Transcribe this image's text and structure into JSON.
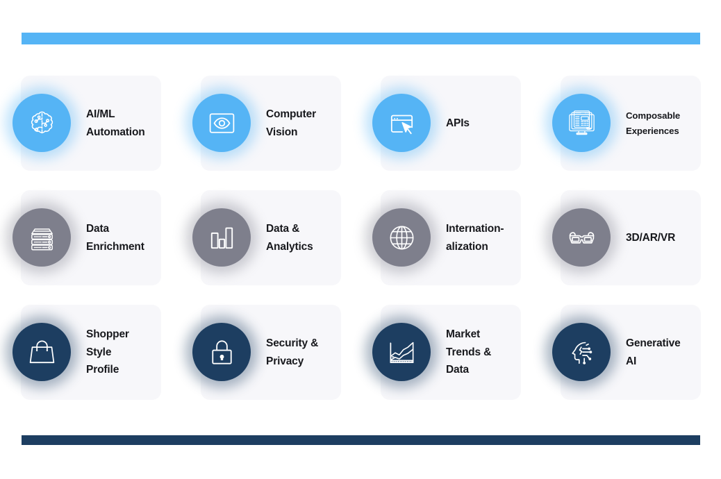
{
  "colors": {
    "accent_blue": "#55b4f5",
    "accent_navy": "#1d3e61",
    "icon_gray": "#7e7f8c",
    "card_bg": "#f7f7fa",
    "label_text": "#17181c",
    "page_bg": "#ffffff"
  },
  "bars": {
    "top": {
      "name": "top-accent-bar",
      "color": "#55b4f5"
    },
    "bottom": {
      "name": "bottom-accent-bar",
      "color": "#1d3e61"
    }
  },
  "rows": [
    {
      "row_color": "#55b4f5",
      "cards": [
        {
          "label": "AI/ML\nAutomation",
          "icon": "brain-circuit-icon",
          "size": "normal"
        },
        {
          "label": "Computer\nVision",
          "icon": "eye-in-frame-icon",
          "size": "normal"
        },
        {
          "label": "APIs",
          "icon": "browser-cursor-icon",
          "size": "normal"
        },
        {
          "label": "Composable\nExperiences",
          "icon": "desktop-layout-icon",
          "size": "small"
        }
      ]
    },
    {
      "row_color": "#7e7f8c",
      "cards": [
        {
          "label": "Data\nEnrichment",
          "icon": "server-stack-icon",
          "size": "normal"
        },
        {
          "label": "Data &\nAnalytics",
          "icon": "bar-chart-icon",
          "size": "normal"
        },
        {
          "label": "Internation-\nalization",
          "icon": "globe-icon",
          "size": "normal"
        },
        {
          "label": "3D/AR/VR",
          "icon": "3d-glasses-icon",
          "size": "normal"
        }
      ]
    },
    {
      "row_color": "#1d3e61",
      "cards": [
        {
          "label": "Shopper\nStyle\nProfile",
          "icon": "shopping-bag-icon",
          "size": "normal"
        },
        {
          "label": "Security &\nPrivacy",
          "icon": "padlock-icon",
          "size": "normal"
        },
        {
          "label": "Market\nTrends &\nData",
          "icon": "trend-chart-icon",
          "size": "normal"
        },
        {
          "label": "Generative\nAI",
          "icon": "ai-head-circuit-icon",
          "size": "normal"
        }
      ]
    }
  ]
}
